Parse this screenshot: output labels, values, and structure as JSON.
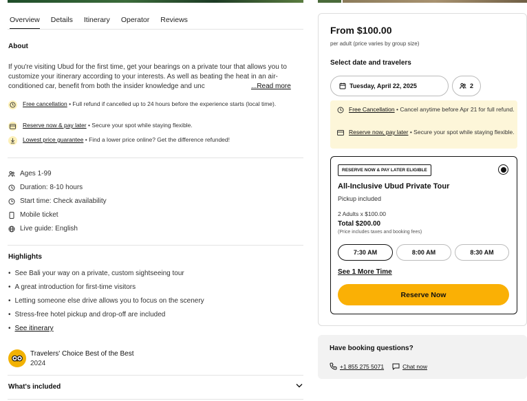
{
  "tabs": [
    "Overview",
    "Details",
    "Itinerary",
    "Operator",
    "Reviews"
  ],
  "about": {
    "title": "About",
    "text": "If you're visiting Ubud for the first time, get your bearings on a private tour that allows you to customize your itinerary according to your interests. As well as beating the heat in an air-conditioned car, benefit from both the insider knowledge and unc",
    "read_more": "...Read more"
  },
  "perks": [
    {
      "icon": "clock-cancel-icon",
      "link": "Free cancellation",
      "text": " • Full refund if cancelled up to 24 hours before the experience starts (local time)."
    },
    {
      "icon": "wallet-icon",
      "link": "Reserve now & pay later",
      "text": " • Secure your spot while staying flexible."
    },
    {
      "icon": "price-tag-icon",
      "link": "Lowest price guarantee",
      "text": " • Find a lower price online? Get the difference refunded!"
    }
  ],
  "details": [
    {
      "icon": "group-icon",
      "label": "Ages 1-99"
    },
    {
      "icon": "timer-icon",
      "label": "Duration: 8-10 hours"
    },
    {
      "icon": "clock-icon",
      "label": "Start time: Check availability"
    },
    {
      "icon": "mobile-icon",
      "label": "Mobile ticket"
    },
    {
      "icon": "globe-icon",
      "label": "Live guide: English"
    }
  ],
  "highlights": {
    "title": "Highlights",
    "items": [
      "See Bali your way on a private, custom sightseeing tour",
      "A great introduction for first-time visitors",
      "Letting someone else drive allows you to focus on the scenery",
      "Stress-free hotel pickup and drop-off are included"
    ],
    "see_itinerary": "See itinerary"
  },
  "award": {
    "title": "Travelers' Choice Best of the Best",
    "year": "2024"
  },
  "included": {
    "title": "What's included"
  },
  "booking": {
    "price": "From $100.00",
    "per_adult": "per adult (price varies by group size)",
    "select_title": "Select date and travelers",
    "date": "Tuesday, April 22, 2025",
    "travelers": "2",
    "info": [
      {
        "icon": "clock-cancel-icon",
        "link": "Free Cancellation",
        "text": " • Cancel anytime before Apr 21 for full refund."
      },
      {
        "icon": "wallet-icon",
        "link": "Reserve now, pay later",
        "text": " • Secure your spot while staying flexible."
      }
    ],
    "option": {
      "badge": "RESERVE NOW & PAY LATER ELIGIBLE",
      "title": "All-Inclusive Ubud Private Tour",
      "pickup": "Pickup included",
      "calc": "2 Adults x $100.00",
      "total": "Total $200.00",
      "taxes": "(Price includes taxes and booking fees)",
      "times": [
        "7:30 AM",
        "8:00 AM",
        "8:30 AM"
      ],
      "see_more": "See 1 More Time",
      "reserve": "Reserve Now"
    }
  },
  "questions": {
    "title": "Have booking questions?",
    "phone": "+1 855 275 5071",
    "chat": "Chat now"
  },
  "colors": {
    "accent": "#fab005",
    "info_bg": "#fdf6d9",
    "badge": "#f2b203"
  }
}
